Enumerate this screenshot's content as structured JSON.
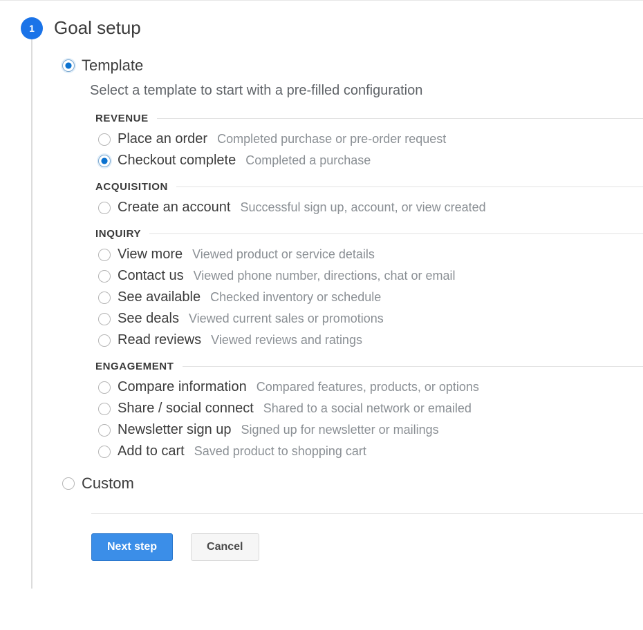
{
  "step": {
    "number": "1",
    "title": "Goal setup"
  },
  "mainOptions": {
    "template": {
      "label": "Template",
      "selected": true
    },
    "custom": {
      "label": "Custom",
      "selected": false
    }
  },
  "subtext": "Select a template to start with a pre-filled configuration",
  "groups": [
    {
      "title": "REVENUE",
      "items": [
        {
          "label": "Place an order",
          "desc": "Completed purchase or pre-order request",
          "selected": false
        },
        {
          "label": "Checkout complete",
          "desc": "Completed a purchase",
          "selected": true
        }
      ]
    },
    {
      "title": "ACQUISITION",
      "items": [
        {
          "label": "Create an account",
          "desc": "Successful sign up, account, or view created",
          "selected": false
        }
      ]
    },
    {
      "title": "INQUIRY",
      "items": [
        {
          "label": "View more",
          "desc": "Viewed product or service details",
          "selected": false
        },
        {
          "label": "Contact us",
          "desc": "Viewed phone number, directions, chat or email",
          "selected": false
        },
        {
          "label": "See available",
          "desc": "Checked inventory or schedule",
          "selected": false
        },
        {
          "label": "See deals",
          "desc": "Viewed current sales or promotions",
          "selected": false
        },
        {
          "label": "Read reviews",
          "desc": "Viewed reviews and ratings",
          "selected": false
        }
      ]
    },
    {
      "title": "ENGAGEMENT",
      "items": [
        {
          "label": "Compare information",
          "desc": "Compared features, products, or options",
          "selected": false
        },
        {
          "label": "Share / social connect",
          "desc": "Shared to a social network or emailed",
          "selected": false
        },
        {
          "label": "Newsletter sign up",
          "desc": "Signed up for newsletter or mailings",
          "selected": false
        },
        {
          "label": "Add to cart",
          "desc": "Saved product to shopping cart",
          "selected": false
        }
      ]
    }
  ],
  "buttons": {
    "next": "Next step",
    "cancel": "Cancel"
  }
}
